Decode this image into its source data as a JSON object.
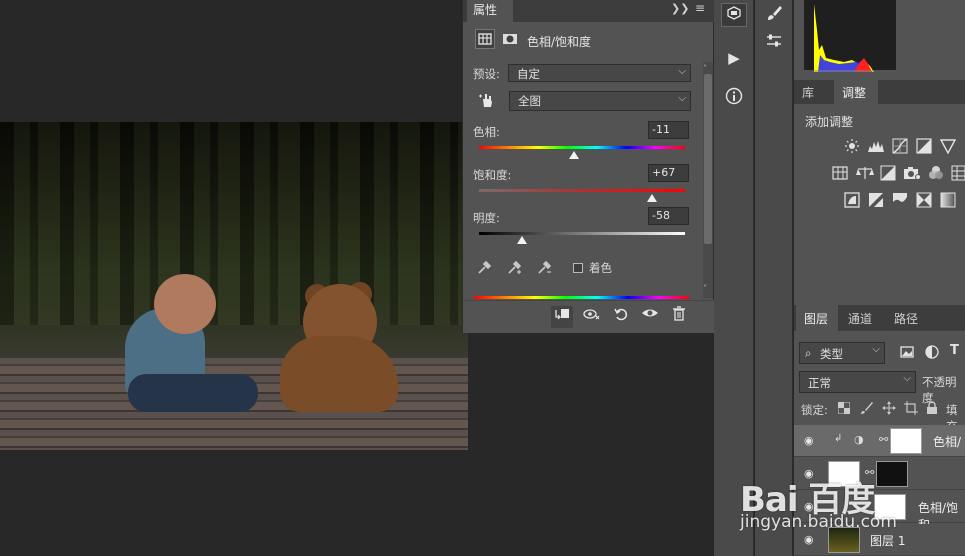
{
  "properties": {
    "tab_label": "属性",
    "collapse_icon": "double-chevron-right",
    "menu_icon": "menu-lines",
    "adjustment_title": "色相/饱和度",
    "preset_label": "预设:",
    "preset_value": "自定",
    "channel_value": "全图",
    "hue": {
      "label": "色相:",
      "value": "-11",
      "position": 0.46
    },
    "saturation": {
      "label": "饱和度:",
      "value": "+67",
      "position": 0.84
    },
    "lightness": {
      "label": "明度:",
      "value": "-58",
      "position": 0.21
    },
    "colorize_label": "着色"
  },
  "adjustments": {
    "tabs": [
      "库",
      "调整"
    ],
    "add_label": "添加调整"
  },
  "layers": {
    "tabs": [
      "图层",
      "通道",
      "路径"
    ],
    "filter_label": "类型",
    "blend_mode": "正常",
    "opacity_label": "不透明度",
    "lock_label": "锁定:",
    "fill_label": "填充",
    "rows": [
      {
        "name": "色相/",
        "selected": true
      },
      {
        "name": "",
        "selected": false
      },
      {
        "name": "色相/饱和",
        "selected": false
      },
      {
        "name": "图层 1",
        "selected": false
      }
    ]
  },
  "watermark": {
    "logo": "Bai 百度",
    "url": "jingyan.baidu.com"
  },
  "colors": {
    "panel_bg": "#535353",
    "canvas_bg": "#282828",
    "tab_bar": "#3c3c3c"
  }
}
